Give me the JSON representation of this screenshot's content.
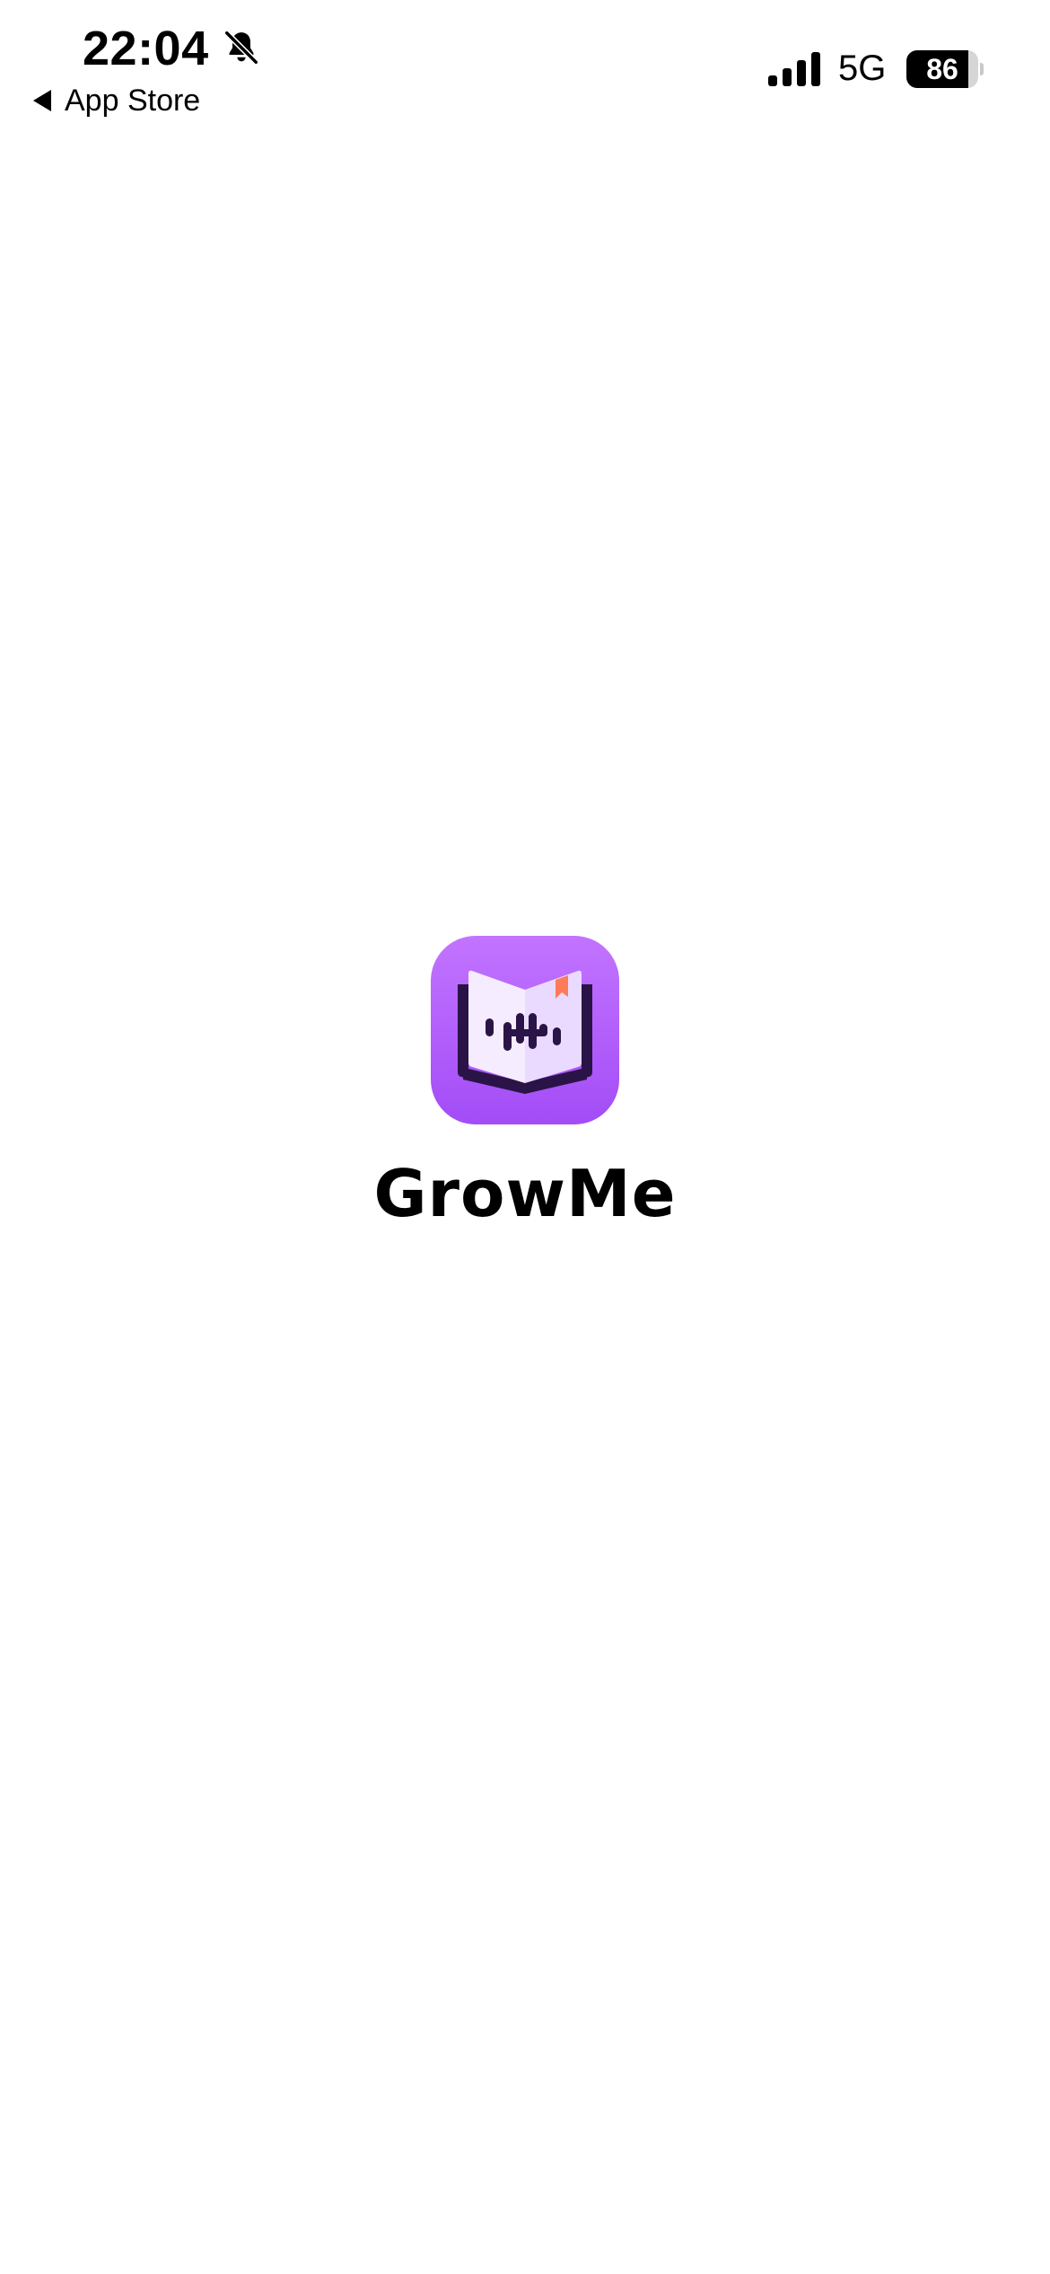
{
  "status_bar": {
    "time": "22:04",
    "back_label": "App Store",
    "network": "5G",
    "battery_level": "86",
    "battery_fraction": 0.86,
    "icons": {
      "mute": "bell-slash-icon",
      "back": "back-triangle-icon",
      "signal": "cellular-signal-icon",
      "battery": "battery-icon"
    }
  },
  "splash": {
    "app_name": "GrowMe",
    "app_icon": "open-book-audio-wave-icon"
  },
  "colors": {
    "background": "#ffffff",
    "icon_purple_light": "#c274ff",
    "icon_purple_dark": "#a34cf7",
    "book_dark": "#2a1447",
    "page_light": "#f6ecff",
    "bookmark": "#ff7a59",
    "text": "#000000"
  }
}
